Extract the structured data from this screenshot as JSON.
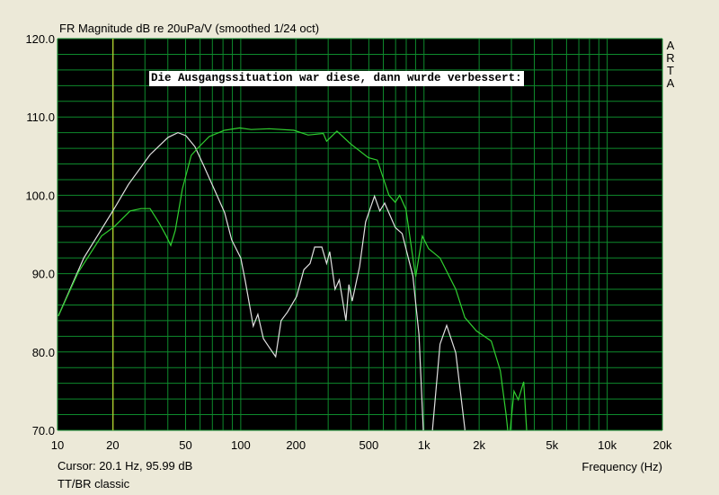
{
  "chart_data": {
    "type": "line",
    "title": "FR Magnitude dB re 20uPa/V (smoothed 1/24 oct)",
    "xlabel": "Frequency (Hz)",
    "ylabel": "",
    "xscale": "log",
    "xlim": [
      10,
      20000
    ],
    "ylim": [
      70,
      120
    ],
    "grid": true,
    "x_ticks": [
      10,
      20,
      50,
      100,
      200,
      500,
      1000,
      2000,
      5000,
      10000,
      20000
    ],
    "x_tick_labels": [
      "10",
      "20",
      "50",
      "100",
      "200",
      "500",
      "1k",
      "2k",
      "5k",
      "10k",
      "20k"
    ],
    "y_ticks": [
      70,
      80,
      90,
      100,
      110,
      120
    ],
    "y_tick_labels": [
      "70.0",
      "80.0",
      "90.0",
      "100.0",
      "110.0",
      "120.0"
    ],
    "annotation": "Die Ausgangssituation war diese, dann wurde verbessert:",
    "cursor": {
      "freq_hz": 20.1,
      "db": 95.99,
      "color": "#e8e830"
    },
    "series": [
      {
        "name": "white",
        "color": "#e0e0e0",
        "x": [
          10.1,
          13.9,
          20.4,
          24.4,
          32,
          40.1,
          45.4,
          50.2,
          56.2,
          63,
          70.6,
          81.6,
          89.2,
          100,
          105.9,
          117,
          124,
          133,
          143,
          155,
          166,
          180,
          202,
          221,
          239,
          253,
          277,
          294,
          306,
          327,
          345,
          375,
          389,
          406,
          445,
          480,
          537,
          574,
          610,
          697,
          760,
          870,
          939,
          990,
          1030,
          1080,
          1114,
          1224,
          1330,
          1490,
          1670,
          1720
        ],
        "y": [
          84.6,
          92.0,
          98.3,
          101.4,
          105.2,
          107.4,
          108.0,
          107.6,
          106.2,
          103.7,
          101.1,
          97.8,
          94.3,
          92.0,
          89.0,
          83.3,
          84.8,
          81.7,
          80.6,
          79.4,
          84.0,
          85.1,
          87.1,
          90.5,
          91.3,
          93.4,
          93.4,
          91.3,
          92.8,
          88.0,
          89.2,
          84.0,
          88.6,
          86.5,
          90.9,
          96.6,
          99.9,
          98.0,
          99.0,
          95.9,
          95.1,
          89.7,
          82.2,
          70.2,
          60,
          60,
          70.2,
          81.0,
          83.4,
          79.9,
          70.2,
          60
        ]
      },
      {
        "name": "green",
        "color": "#30d030",
        "x": [
          10.1,
          13,
          17.4,
          20.4,
          24.9,
          28.6,
          32,
          35.8,
          39.2,
          41.5,
          43.9,
          48,
          53.7,
          58.1,
          67.3,
          81.6,
          98.7,
          114,
          143,
          195,
          233,
          282,
          294,
          335,
          396,
          497,
          556,
          644,
          697,
          737,
          797,
          870,
          901,
          979,
          1059,
          1224,
          1490,
          1670,
          1930,
          2330,
          2610,
          2800,
          2860,
          2900,
          2960,
          3100,
          3270,
          3500,
          3630,
          3680
        ],
        "y": [
          84.6,
          90.2,
          94.8,
          96.0,
          98.0,
          98.3,
          98.3,
          96.5,
          94.8,
          93.6,
          95.5,
          100.8,
          105.1,
          106.0,
          107.5,
          108.3,
          108.6,
          108.4,
          108.5,
          108.3,
          107.7,
          107.9,
          106.9,
          108.2,
          106.6,
          104.8,
          104.5,
          100.0,
          99.1,
          100.0,
          98.2,
          92.0,
          89.6,
          94.8,
          93.2,
          92.0,
          88.0,
          84.4,
          82.7,
          81.4,
          77.6,
          72.2,
          70.2,
          62,
          70.2,
          75.0,
          73.9,
          76.2,
          70.2,
          62
        ]
      }
    ]
  },
  "cursor_readout": "Cursor: 20.1 Hz, 95.99 dB",
  "mode_label": "TT/BR classic",
  "brand_letters": [
    "A",
    "R",
    "T",
    "A"
  ]
}
